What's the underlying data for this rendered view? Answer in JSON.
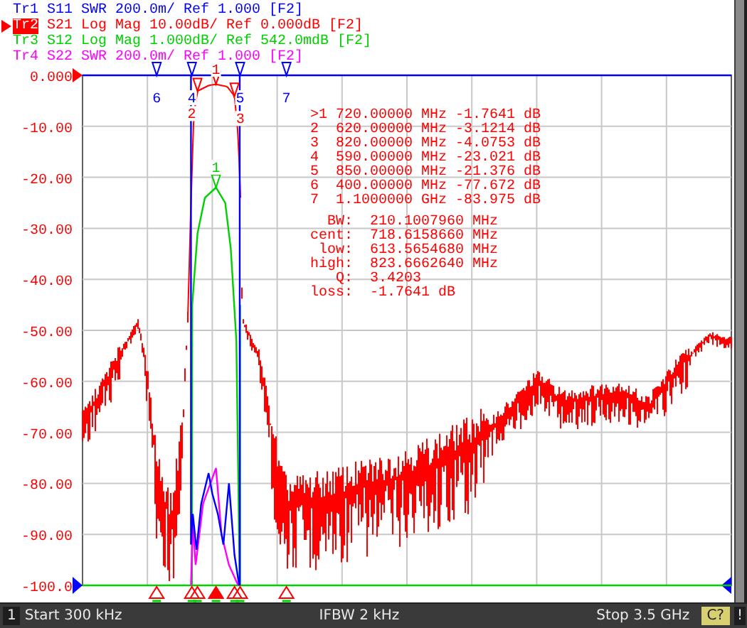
{
  "traces": [
    {
      "label": "Tr1",
      "text": "S11 SWR 200.0m/ Ref 1.000 [F2]",
      "color": "#0000ff",
      "selected": false
    },
    {
      "label": "Tr2",
      "text": "S21 Log Mag 10.00dB/ Ref 0.000dB [F2]",
      "color": "#ff0000",
      "selected": true
    },
    {
      "label": "Tr3",
      "text": "S12 Log Mag 1.000dB/ Ref 542.0mdB [F2]",
      "color": "#00d000",
      "selected": false
    },
    {
      "label": "Tr4",
      "text": "S22 SWR 200.0m/ Ref 1.000 [F2]",
      "color": "#ff00ff",
      "selected": false
    }
  ],
  "y_axis": [
    "0.000",
    "-10.00",
    "-20.00",
    "-30.00",
    "-40.00",
    "-50.00",
    "-60.00",
    "-70.00",
    "-80.00",
    "-90.00",
    "-100.0"
  ],
  "plot_markers": [
    {
      "text": "6",
      "color": "#0000ff"
    },
    {
      "text": "4",
      "color": "#0000ff"
    },
    {
      "text": "5",
      "color": "#0000ff"
    },
    {
      "text": "7",
      "color": "#0000ff"
    },
    {
      "text": "1",
      "color": "#ff0000"
    },
    {
      "text": "2",
      "color": "#ff0000"
    },
    {
      "text": "3",
      "color": "#ff0000"
    },
    {
      "text": "1",
      "color": "#00d000"
    }
  ],
  "markers": [
    {
      "id": ">1",
      "frequency": "720.00000 MHz",
      "value": "-1.7641 dB"
    },
    {
      "id": "2",
      "frequency": "620.00000 MHz",
      "value": "-3.1214 dB"
    },
    {
      "id": "3",
      "frequency": "820.00000 MHz",
      "value": "-4.0753 dB"
    },
    {
      "id": "4",
      "frequency": "590.00000 MHz",
      "value": "-23.021 dB"
    },
    {
      "id": "5",
      "frequency": "850.00000 MHz",
      "value": "-21.376 dB"
    },
    {
      "id": "6",
      "frequency": "400.00000 MHz",
      "value": "-77.672 dB"
    },
    {
      "id": "7",
      "frequency": "1.1000000 GHz",
      "value": "-83.975 dB"
    }
  ],
  "statistics": [
    {
      "label": "BW:",
      "value": "210.1007960 MHz"
    },
    {
      "label": "cent:",
      "value": "718.6158660 MHz"
    },
    {
      "label": "low:",
      "value": "613.5654680 MHz"
    },
    {
      "label": "high:",
      "value": "823.6662640 MHz"
    },
    {
      "label": "Q:",
      "value": "3.4203"
    },
    {
      "label": "loss:",
      "value": "-1.7641 dB"
    }
  ],
  "status_bar": {
    "channel": "1",
    "start": "Start 300 kHz",
    "ifbw": "IFBW 2 kHz",
    "stop": "Stop 3.5 GHz",
    "calibration": "C?",
    "alert": "!"
  }
}
